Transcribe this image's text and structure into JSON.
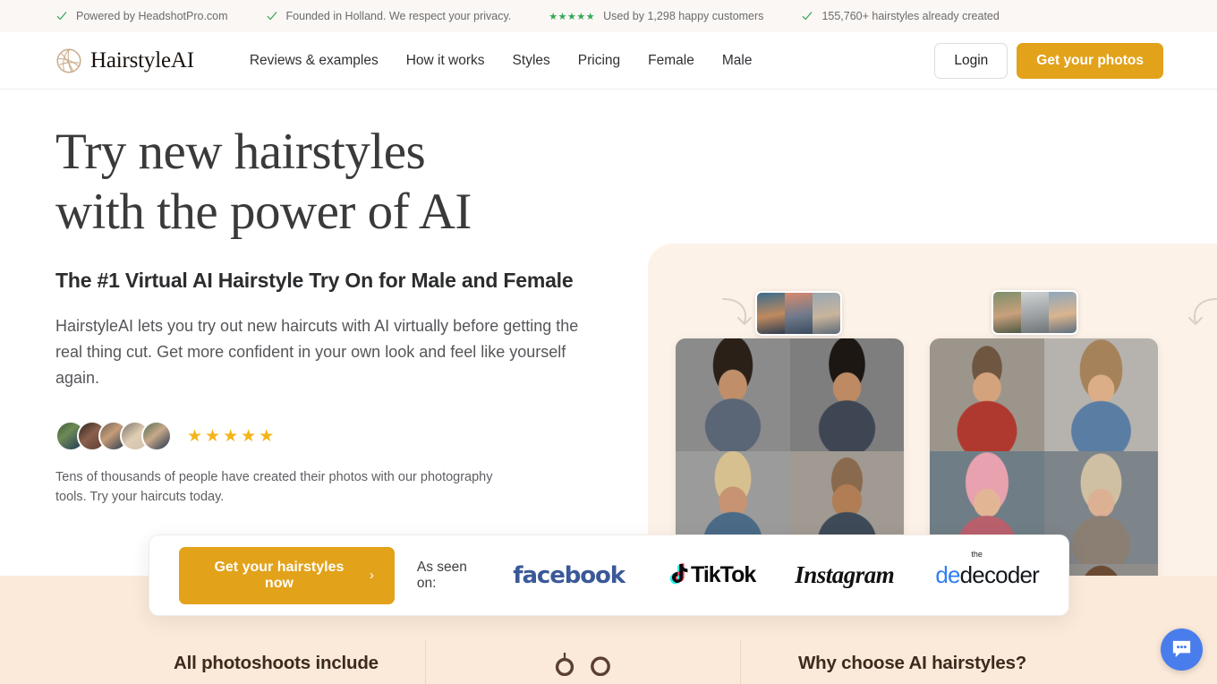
{
  "topbar": {
    "items": [
      {
        "icon": "check-icon",
        "text": "Powered by HeadshotPro.com"
      },
      {
        "icon": "check-icon",
        "text": "Founded in Holland. We respect your privacy."
      },
      {
        "icon": "stars-icon",
        "stars": 5,
        "text": "Used by 1,298 happy customers"
      },
      {
        "icon": "check-icon",
        "text": "155,760+ hairstyles already created"
      }
    ],
    "check_color": "#34a853",
    "star_color": "#34a853"
  },
  "header": {
    "brand": "HairstyleAI",
    "nav": [
      {
        "label": "Reviews & examples"
      },
      {
        "label": "How it works"
      },
      {
        "label": "Styles"
      },
      {
        "label": "Pricing"
      },
      {
        "label": "Female"
      },
      {
        "label": "Male"
      }
    ],
    "login_label": "Login",
    "cta_label": "Get your photos",
    "accent": "#e2a21a"
  },
  "hero": {
    "heading_line1": "Try new hairstyles",
    "heading_line2": "with the power of AI",
    "subheading": "The #1 Virtual AI Hairstyle Try On for Male and Female",
    "paragraph": "HairstyleAI lets you try out new haircuts with AI virtually before getting the real thing cut. Get more confident in your own look and feel like yourself again.",
    "rating_stars": 5,
    "rating_star_color": "#f5b518",
    "proof_text": "Tens of thousands of people have created their photos with our photography tools. Try your haircuts today.",
    "avatars": [
      {
        "name": "avatar-1",
        "colors": [
          "#3d5a3a",
          "#1c3557"
        ]
      },
      {
        "name": "avatar-2",
        "colors": [
          "#2a2320",
          "#5c3b33"
        ]
      },
      {
        "name": "avatar-3",
        "colors": [
          "#6d6154",
          "#243349"
        ]
      },
      {
        "name": "avatar-4",
        "colors": [
          "#7a7468",
          "#cfc0ad"
        ]
      },
      {
        "name": "avatar-5",
        "colors": [
          "#4e6b52",
          "#20344f"
        ]
      }
    ]
  },
  "showcase": {
    "left_grid": [
      {
        "name": "curly-dark-hair",
        "hair": "#2a2018",
        "skin": "#c08f6a",
        "bg": "#8b8b8b",
        "shirt": "#5a6575"
      },
      {
        "name": "pompadour-fade",
        "hair": "#1d1713",
        "skin": "#bd8a64",
        "bg": "#7e7e7e",
        "shirt": "#3f4653"
      },
      {
        "name": "blonde-side-part",
        "hair": "#d6c08f",
        "skin": "#c79372",
        "bg": "#9b9b9b",
        "shirt": "#4a6a86"
      },
      {
        "name": "bald-shaved",
        "hair": "#8a6a4e",
        "skin": "#b07d55",
        "bg": "#a09a92",
        "shirt": "#3e4a58"
      },
      {
        "name": "long-wavy-brunette",
        "hair": "#2e211a",
        "skin": "#c08f6a",
        "bg": "#8f8f8f",
        "shirt": "#2f3845"
      },
      {
        "name": "grey-short-crop",
        "hair": "#a9a7a3",
        "skin": "#b98b68",
        "bg": "#8a8a8a",
        "shirt": "#55606e"
      }
    ],
    "right_grid": [
      {
        "name": "buzzcut-woman",
        "hair": "#6e5640",
        "skin": "#d3a37e",
        "bg": "#9c958b",
        "shirt": "#b0392f"
      },
      {
        "name": "bob-with-bangs",
        "hair": "#a6825a",
        "skin": "#dcae88",
        "bg": "#b6b2ad",
        "shirt": "#5a7da4"
      },
      {
        "name": "pink-hair",
        "hair": "#e8a1ae",
        "skin": "#e2b694",
        "bg": "#6f7d86",
        "shirt": "#b9606d"
      },
      {
        "name": "platinum-bob",
        "hair": "#cfc0a4",
        "skin": "#dcb093",
        "bg": "#7d848a",
        "shirt": "#8b7f74"
      },
      {
        "name": "updo-blonde",
        "hair": "#c9a濃",
        "skin": "#e0b493",
        "bg": "#99928a",
        "shirt": "#6c5f54"
      },
      {
        "name": "long-brown-waves",
        "hair": "#6b4a33",
        "skin": "#d9a682",
        "bg": "#8e8d8a",
        "shirt": "#4e4a46"
      }
    ],
    "left_strip": [
      {
        "name": "source-photo-1",
        "a": "#3a6d8c",
        "b": "#c0895f"
      },
      {
        "name": "source-photo-2",
        "a": "#d78a6e",
        "b": "#3c4a5e"
      },
      {
        "name": "source-photo-3",
        "a": "#9aa8b4",
        "b": "#5d6b78"
      }
    ],
    "right_strip": [
      {
        "name": "source-photo-4",
        "a": "#7d8f6b",
        "b": "#c9a07c"
      },
      {
        "name": "source-photo-5",
        "a": "#b9bcbd",
        "b": "#8e9294"
      },
      {
        "name": "source-photo-6",
        "a": "#8fa7bd",
        "b": "#d9b48e"
      }
    ]
  },
  "cta_card": {
    "button_label": "Get your hairstyles now",
    "chevron": "›",
    "seen_on_label": "As seen on:",
    "logos": [
      {
        "name": "facebook-logo",
        "text": "facebook",
        "color": "#3b5998"
      },
      {
        "name": "tiktok-logo",
        "text": "TikTok",
        "color": "#0b0b0b"
      },
      {
        "name": "instagram-logo",
        "text": "Instagram",
        "color": "#111111"
      },
      {
        "name": "decoder-logo",
        "text": "decoder",
        "prefix": "de",
        "superscript": "the",
        "color": "#2f7df6"
      }
    ]
  },
  "bottom_section": {
    "left_heading": "All photoshoots include",
    "right_heading": "Why choose AI hairstyles?",
    "background": "#fbeada"
  },
  "chat_widget": {
    "name": "chat-bubble-icon",
    "color": "#4a7dec"
  }
}
